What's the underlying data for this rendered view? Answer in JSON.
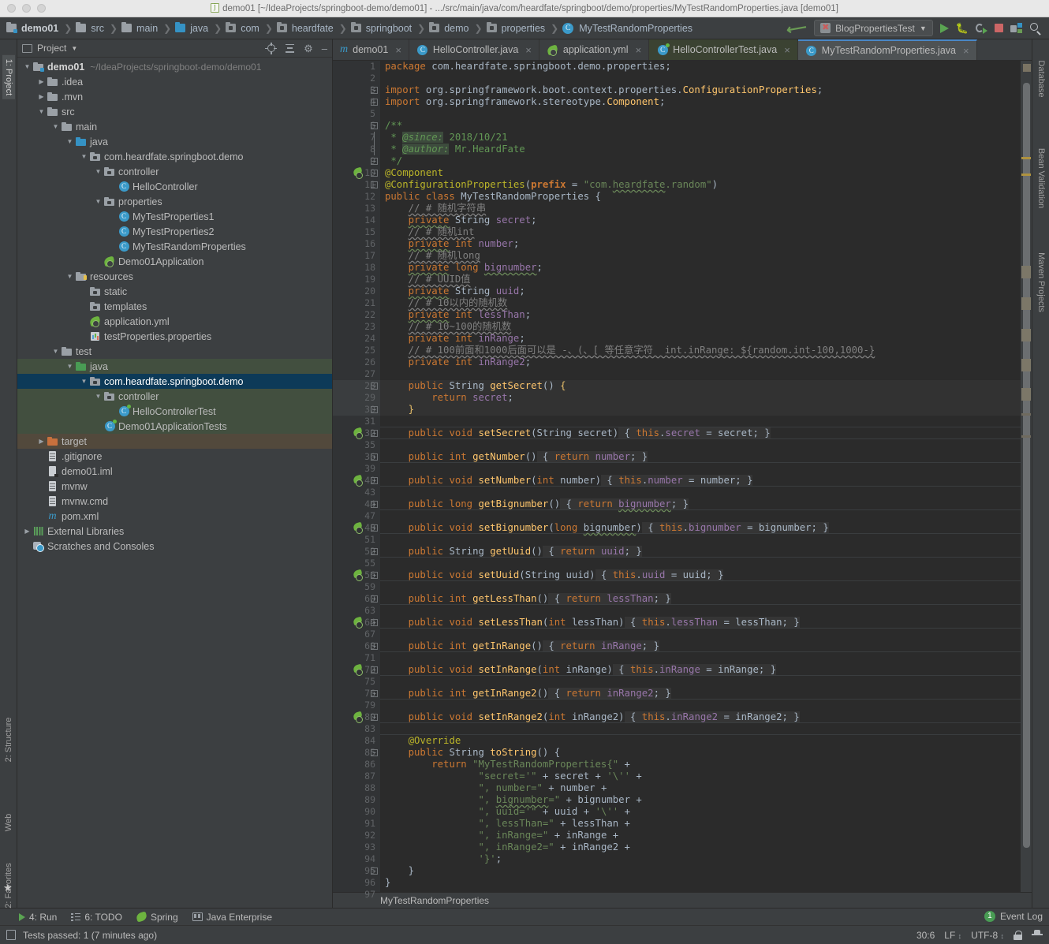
{
  "window": {
    "title": "demo01 [~/IdeaProjects/springboot-demo/demo01] - .../src/main/java/com/heardfate/springboot/demo/properties/MyTestRandomProperties.java [demo01]",
    "app_icon": "intellij-idea-icon"
  },
  "navbar": {
    "crumbs": [
      {
        "label": "demo01",
        "icon": "module-folder-icon",
        "bold": true
      },
      {
        "label": "src",
        "icon": "folder-icon",
        "bold": false
      },
      {
        "label": "main",
        "icon": "folder-icon",
        "bold": false
      },
      {
        "label": "java",
        "icon": "source-root-folder-icon",
        "bold": false
      },
      {
        "label": "com",
        "icon": "package-icon",
        "bold": false
      },
      {
        "label": "heardfate",
        "icon": "package-icon",
        "bold": false
      },
      {
        "label": "springboot",
        "icon": "package-icon",
        "bold": false
      },
      {
        "label": "demo",
        "icon": "package-icon",
        "bold": false
      },
      {
        "label": "properties",
        "icon": "package-icon",
        "bold": false
      },
      {
        "label": "MyTestRandomProperties",
        "icon": "class-icon",
        "bold": false
      }
    ],
    "run_config": "BlogPropertiesTest",
    "buttons": [
      "back-arrow-icon",
      "run-icon",
      "debug-icon",
      "run-coverage-icon",
      "stop-icon",
      "build-icon",
      "search-everywhere-icon"
    ]
  },
  "project_pane": {
    "title": "Project",
    "header_actions": [
      "locate-icon",
      "collapse-all-icon",
      "settings-gear-icon",
      "hide-icon"
    ],
    "tree": [
      {
        "label": "demo01",
        "sub": "~/IdeaProjects/springboot-demo/demo01",
        "depth": 0,
        "arrow": "down",
        "icon": "module-folder-icon",
        "bold": true
      },
      {
        "label": ".idea",
        "depth": 1,
        "arrow": "right",
        "icon": "folder-icon"
      },
      {
        "label": ".mvn",
        "depth": 1,
        "arrow": "right",
        "icon": "folder-icon"
      },
      {
        "label": "src",
        "depth": 1,
        "arrow": "down",
        "icon": "folder-icon"
      },
      {
        "label": "main",
        "depth": 2,
        "arrow": "down",
        "icon": "folder-icon"
      },
      {
        "label": "java",
        "depth": 3,
        "arrow": "down",
        "icon": "source-root-folder-icon"
      },
      {
        "label": "com.heardfate.springboot.demo",
        "depth": 4,
        "arrow": "down",
        "icon": "package-icon"
      },
      {
        "label": "controller",
        "depth": 5,
        "arrow": "down",
        "icon": "package-icon"
      },
      {
        "label": "HelloController",
        "depth": 6,
        "arrow": "none",
        "icon": "class-icon"
      },
      {
        "label": "properties",
        "depth": 5,
        "arrow": "down",
        "icon": "package-icon"
      },
      {
        "label": "MyTestProperties1",
        "depth": 6,
        "arrow": "none",
        "icon": "class-icon"
      },
      {
        "label": "MyTestProperties2",
        "depth": 6,
        "arrow": "none",
        "icon": "class-icon"
      },
      {
        "label": "MyTestRandomProperties",
        "depth": 6,
        "arrow": "none",
        "icon": "class-icon"
      },
      {
        "label": "Demo01Application",
        "depth": 5,
        "arrow": "none",
        "icon": "spring-class-icon"
      },
      {
        "label": "resources",
        "depth": 3,
        "arrow": "down",
        "icon": "resource-folder-icon"
      },
      {
        "label": "static",
        "depth": 4,
        "arrow": "none",
        "icon": "package-icon"
      },
      {
        "label": "templates",
        "depth": 4,
        "arrow": "none",
        "icon": "package-icon"
      },
      {
        "label": "application.yml",
        "depth": 4,
        "arrow": "none",
        "icon": "spring-yaml-icon"
      },
      {
        "label": "testProperties.properties",
        "depth": 4,
        "arrow": "none",
        "icon": "properties-file-icon"
      },
      {
        "label": "test",
        "depth": 2,
        "arrow": "down",
        "icon": "folder-icon"
      },
      {
        "label": "java",
        "depth": 3,
        "arrow": "down",
        "icon": "test-source-root-icon",
        "highlight": "green"
      },
      {
        "label": "com.heardfate.springboot.demo",
        "depth": 4,
        "arrow": "down",
        "icon": "package-icon",
        "selected": true
      },
      {
        "label": "controller",
        "depth": 5,
        "arrow": "down",
        "icon": "package-icon",
        "highlight": "green"
      },
      {
        "label": "HelloControllerTest",
        "depth": 6,
        "arrow": "none",
        "icon": "test-class-icon",
        "highlight": "green"
      },
      {
        "label": "Demo01ApplicationTests",
        "depth": 5,
        "arrow": "none",
        "icon": "test-class-icon",
        "highlight": "green"
      },
      {
        "label": "target",
        "depth": 1,
        "arrow": "right",
        "icon": "excluded-folder-icon",
        "highlight": "brown"
      },
      {
        "label": ".gitignore",
        "depth": 1,
        "arrow": "none",
        "icon": "file-icon"
      },
      {
        "label": "demo01.iml",
        "depth": 1,
        "arrow": "none",
        "icon": "iml-file-icon"
      },
      {
        "label": "mvnw",
        "depth": 1,
        "arrow": "none",
        "icon": "file-icon"
      },
      {
        "label": "mvnw.cmd",
        "depth": 1,
        "arrow": "none",
        "icon": "file-icon"
      },
      {
        "label": "pom.xml",
        "depth": 1,
        "arrow": "none",
        "icon": "maven-pom-icon"
      },
      {
        "label": "External Libraries",
        "depth": 0,
        "arrow": "right",
        "icon": "libraries-icon"
      },
      {
        "label": "Scratches and Consoles",
        "depth": 0,
        "arrow": "none",
        "icon": "scratches-icon"
      }
    ]
  },
  "left_rail": [
    {
      "label": "1: Project",
      "active": true
    },
    {
      "label": "2: Structure",
      "active": false
    },
    {
      "label": "Web",
      "active": false
    },
    {
      "label": "2: Favorites",
      "active": false
    }
  ],
  "right_rail": [
    {
      "label": "Database"
    },
    {
      "label": "Bean Validation"
    },
    {
      "label": "Maven Projects"
    }
  ],
  "tabs": [
    {
      "label": "demo01",
      "icon": "maven-module-icon",
      "state": "normal"
    },
    {
      "label": "HelloController.java",
      "icon": "class-icon",
      "state": "normal"
    },
    {
      "label": "application.yml",
      "icon": "spring-yaml-icon",
      "state": "normal"
    },
    {
      "label": "HelloControllerTest.java",
      "icon": "test-class-icon",
      "state": "green"
    },
    {
      "label": "MyTestRandomProperties.java",
      "icon": "class-icon",
      "state": "selected"
    }
  ],
  "editor": {
    "file_breadcrumb": "MyTestRandomProperties",
    "lines": [
      {
        "n": "1",
        "html": "<span class='kw'>package</span> com.heardfate.springboot.demo.properties;"
      },
      {
        "n": "2",
        "html": ""
      },
      {
        "n": "3",
        "html": "<span class='kw'>import</span> org.springframework.boot.context.properties.<span class='mth'>ConfigurationProperties</span>;",
        "fold": "minus"
      },
      {
        "n": "4",
        "html": "<span class='kw'>import</span> org.springframework.stereotype.<span class='mth'>Component</span>;",
        "fold": "minus"
      },
      {
        "n": "5",
        "html": ""
      },
      {
        "n": "6",
        "html": "<span class='doc'>/**</span>",
        "fold": "minus"
      },
      {
        "n": "7",
        "html": "<span class='doc'> * </span><span class='dtag hl-doc'>@since:</span><span class='doc'> 2018/10/21</span>",
        "fold": "bar"
      },
      {
        "n": "8",
        "html": "<span class='doc'> * </span><span class='dtag hl-doc'>@author:</span><span class='doc'> Mr.HeardFate</span>",
        "fold": "bar"
      },
      {
        "n": "9",
        "html": "<span class='doc'> */</span>",
        "fold": "minus"
      },
      {
        "n": "10",
        "html": "<span class='ann'>@Component</span>",
        "gutter": "spring",
        "fold": "minus"
      },
      {
        "n": "11",
        "html": "<span class='ann'>@ConfigurationProperties</span>(<span class='kwb'>prefix</span> = <span class='str'>\"com.</span><span class='str wavy'>heardfate</span><span class='str'>.random\"</span>)",
        "fold": "minus"
      },
      {
        "n": "12",
        "html": "<span class='kw'>public class </span><span class='typ'>MyTestRandomProperties </span>{",
        "gutter": "bean"
      },
      {
        "n": "13",
        "html": "    <span class='cmt-u'>// # 随机字符串</span>"
      },
      {
        "n": "14",
        "html": "    <span class='kw wavy'>private</span> <span class='typ'>String </span><span class='fld'>secret</span>;"
      },
      {
        "n": "15",
        "html": "    <span class='cmt-u'>// # 随机int</span>"
      },
      {
        "n": "16",
        "html": "    <span class='kw wavy'>private</span> <span class='kw'>int </span><span class='fld'>number</span>;"
      },
      {
        "n": "17",
        "html": "    <span class='cmt-u'>// # 随机long</span>"
      },
      {
        "n": "18",
        "html": "    <span class='kw wavy'>private</span> <span class='kw'>long </span><span class='fld wavy'>bignumber</span>;"
      },
      {
        "n": "19",
        "html": "    <span class='cmt-u'>// # UUID值</span>"
      },
      {
        "n": "20",
        "html": "    <span class='kw wavy'>private</span> <span class='typ'>String </span><span class='fld'>uuid</span>;"
      },
      {
        "n": "21",
        "html": "    <span class='cmt-u'>// # 10以内的随机数</span>"
      },
      {
        "n": "22",
        "html": "    <span class='kw wavy'>private</span> <span class='kw'>int </span><span class='fld'>lessThan</span>;"
      },
      {
        "n": "23",
        "html": "    <span class='cmt-u'>// # 10~100的随机数</span>"
      },
      {
        "n": "24",
        "html": "    <span class='kw'>private</span> <span class='kw'>int </span><span class='fld'>inRange</span>;"
      },
      {
        "n": "25",
        "html": "    <span class='cmt-u'>// # 100前面和1000后面可以是 -、(、[ 等任意字符  int.inRange: ${random.int-100,1000-}</span>"
      },
      {
        "n": "26",
        "html": "    <span class='kw'>private</span> <span class='kw'>int </span><span class='fld'>inRange2</span>;"
      },
      {
        "n": "27",
        "html": ""
      },
      {
        "n": "28",
        "html": "    <span class='kw'>public </span><span class='typ'>String </span><span class='mth'>getSecret</span>() <span class='brace-y'>{</span>",
        "fold": "minus",
        "cur": true
      },
      {
        "n": "29",
        "html": "        <span class='kw'>return </span><span class='fld'>secret</span>;",
        "cur": true
      },
      {
        "n": "30",
        "html": "    <span class='brace-y'>}</span>",
        "fold": "minus",
        "cur": true
      },
      {
        "n": "31",
        "html": "",
        "sepbelow": true
      },
      {
        "n": "32",
        "html": "    <span class='kw'>public void </span><span class='mth'>setSecret</span>(<span class='typ'>String </span><span class='white'>secret</span>)<span class='inl'> { </span><span class='kw inl'>this</span><span class='inl'>.</span><span class='fld inl'>secret </span><span class='inl'>= secret; </span><span class='inl'>}</span>",
        "gutter": "spring",
        "fold": "plus",
        "sepbelow": true
      },
      {
        "n": "35",
        "html": ""
      },
      {
        "n": "36",
        "html": "    <span class='kw'>public int </span><span class='mth'>getNumber</span>()<span class='inl'> { </span><span class='kw inl'>return </span><span class='fld inl'>number</span><span class='inl'>; }</span>",
        "fold": "plus",
        "sepbelow": true
      },
      {
        "n": "39",
        "html": ""
      },
      {
        "n": "40",
        "html": "    <span class='kw'>public void </span><span class='mth'>setNumber</span>(<span class='kw'>int </span><span class='white'>number</span>)<span class='inl'> { </span><span class='kw inl'>this</span><span class='inl'>.</span><span class='fld inl'>number </span><span class='inl'>= number; }</span>",
        "gutter": "spring",
        "fold": "plus",
        "sepbelow": true
      },
      {
        "n": "43",
        "html": ""
      },
      {
        "n": "44",
        "html": "    <span class='kw'>public long </span><span class='mth'>getBignumber</span>()<span class='inl'> { </span><span class='kw inl'>return </span><span class='fld inl wavy'>bignumber</span><span class='inl'>; }</span>",
        "fold": "plus",
        "sepbelow": true
      },
      {
        "n": "47",
        "html": ""
      },
      {
        "n": "48",
        "html": "    <span class='kw'>public void </span><span class='mth'>setBignumber</span>(<span class='kw'>long </span><span class='white wavy'>bignumber</span>)<span class='inl'> { </span><span class='kw inl'>this</span><span class='inl'>.</span><span class='fld inl'>bignumber </span><span class='inl'>= bignumber; }</span>",
        "gutter": "spring",
        "fold": "plus",
        "sepbelow": true
      },
      {
        "n": "51",
        "html": ""
      },
      {
        "n": "52",
        "html": "    <span class='kw'>public </span><span class='typ'>String </span><span class='mth'>getUuid</span>()<span class='inl'> { </span><span class='kw inl'>return </span><span class='fld inl'>uuid</span><span class='inl'>; }</span>",
        "fold": "plus",
        "sepbelow": true
      },
      {
        "n": "55",
        "html": ""
      },
      {
        "n": "56",
        "html": "    <span class='kw'>public void </span><span class='mth'>setUuid</span>(<span class='typ'>String </span><span class='white'>uuid</span>)<span class='inl'> { </span><span class='kw inl'>this</span><span class='inl'>.</span><span class='fld inl'>uuid </span><span class='inl'>= uuid; }</span>",
        "gutter": "spring",
        "fold": "plus",
        "sepbelow": true
      },
      {
        "n": "59",
        "html": ""
      },
      {
        "n": "60",
        "html": "    <span class='kw'>public int </span><span class='mth'>getLessThan</span>()<span class='inl'> { </span><span class='kw inl'>return </span><span class='fld inl'>lessThan</span><span class='inl'>; }</span>",
        "fold": "plus",
        "sepbelow": true
      },
      {
        "n": "63",
        "html": ""
      },
      {
        "n": "64",
        "html": "    <span class='kw'>public void </span><span class='mth'>setLessThan</span>(<span class='kw'>int </span><span class='white'>lessThan</span>)<span class='inl'> { </span><span class='kw inl'>this</span><span class='inl'>.</span><span class='fld inl'>lessThan </span><span class='inl'>= lessThan; }</span>",
        "gutter": "spring",
        "fold": "plus",
        "sepbelow": true
      },
      {
        "n": "67",
        "html": ""
      },
      {
        "n": "68",
        "html": "    <span class='kw'>public int </span><span class='mth'>getInRange</span>()<span class='inl'> { </span><span class='kw inl'>return </span><span class='fld inl'>inRange</span><span class='inl'>; }</span>",
        "fold": "plus",
        "sepbelow": true
      },
      {
        "n": "71",
        "html": ""
      },
      {
        "n": "72",
        "html": "    <span class='kw'>public void </span><span class='mth'>setInRange</span>(<span class='kw'>int </span><span class='white'>inRange</span>)<span class='inl'> { </span><span class='kw inl'>this</span><span class='inl'>.</span><span class='fld inl'>inRange </span><span class='inl'>= inRange; }</span>",
        "gutter": "spring",
        "fold": "plus",
        "sepbelow": true
      },
      {
        "n": "75",
        "html": ""
      },
      {
        "n": "76",
        "html": "    <span class='kw'>public int </span><span class='mth'>getInRange2</span>()<span class='inl'> { </span><span class='kw inl'>return </span><span class='fld inl'>inRange2</span><span class='inl'>; }</span>",
        "fold": "plus",
        "sepbelow": true
      },
      {
        "n": "79",
        "html": ""
      },
      {
        "n": "80",
        "html": "    <span class='kw'>public void </span><span class='mth'>setInRange2</span>(<span class='kw'>int </span><span class='white'>inRange2</span>)<span class='inl'> { </span><span class='kw inl'>this</span><span class='inl'>.</span><span class='fld inl'>inRange2 </span><span class='inl'>= inRange2; }</span>",
        "gutter": "spring",
        "fold": "plus",
        "sepbelow": true
      },
      {
        "n": "83",
        "html": "",
        "sepbelow": true
      },
      {
        "n": "84",
        "html": "    <span class='ann'>@Override</span>"
      },
      {
        "n": "85",
        "html": "    <span class='kw'>public </span><span class='typ'>String </span><span class='mth'>toString</span>() {",
        "gutter": "override",
        "fold": "minus"
      },
      {
        "n": "86",
        "html": "        <span class='kw'>return </span><span class='str'>\"MyTestRandomProperties{\"</span> +"
      },
      {
        "n": "87",
        "html": "                <span class='str'>\"secret='\"</span> + secret + <span class='str'>'\\<span class=\"kw\"></span>''</span> +"
      },
      {
        "n": "88",
        "html": "                <span class='str'>\", number=\"</span> + number +"
      },
      {
        "n": "89",
        "html": "                <span class='str'>\", </span><span class='str wavy'>bignumber</span><span class='str'>=\"</span> + bignumber +"
      },
      {
        "n": "90",
        "html": "                <span class='str'>\", uuid='\"</span> + uuid + <span class='str'>'\\''</span> +"
      },
      {
        "n": "91",
        "html": "                <span class='str'>\", lessThan=\"</span> + lessThan +"
      },
      {
        "n": "92",
        "html": "                <span class='str'>\", inRange=\"</span> + inRange +"
      },
      {
        "n": "93",
        "html": "                <span class='str'>\", inRange2=\"</span> + inRange2 +"
      },
      {
        "n": "94",
        "html": "                <span class='str'>'}'</span>;"
      },
      {
        "n": "95",
        "html": "    }",
        "fold": "minus"
      },
      {
        "n": "96",
        "html": "}"
      },
      {
        "n": "97",
        "html": ""
      }
    ]
  },
  "toolwindow_bar": [
    {
      "label": "4: Run",
      "icon": "run-icon",
      "mnemonic": "4"
    },
    {
      "label": "6: TODO",
      "icon": "todo-icon",
      "mnemonic": "6"
    },
    {
      "label": "Spring",
      "icon": "spring-icon",
      "mnemonic": ""
    },
    {
      "label": "Java Enterprise",
      "icon": "java-enterprise-icon",
      "mnemonic": ""
    }
  ],
  "status_bar": {
    "message": "Tests passed: 1 (7 minutes ago)",
    "event_log": "Event Log",
    "event_count": "1",
    "caret_position": "30:6",
    "line_separator": "LF",
    "encoding": "UTF-8",
    "lock_icon": "read-only-lock-icon",
    "hat_icon": "power-save-hat-icon"
  }
}
